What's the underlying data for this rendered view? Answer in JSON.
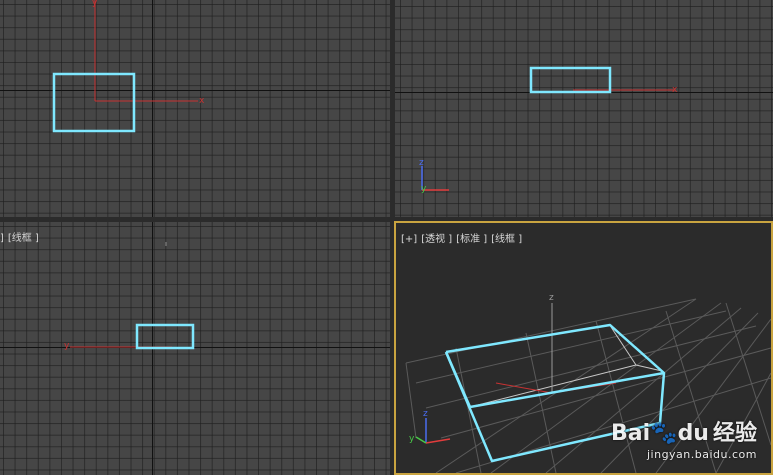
{
  "viewports": {
    "left": {
      "labels": [
        "]",
        "[线框 ]"
      ]
    },
    "perspective": {
      "labels": [
        "[+]",
        "[透视 ]",
        "[标准 ]",
        "[线框 ]"
      ]
    }
  },
  "axis_labels": {
    "x": "x",
    "y": "y",
    "z": "z"
  },
  "colors": {
    "selection": "#7fe8ff",
    "axis": "#c83232",
    "gizmo_x": "#e23c3c",
    "gizmo_y": "#48c848",
    "gizmo_z": "#4a6cf0",
    "active_border": "#c9a440"
  },
  "watermark": {
    "logo": "Bai🐾du",
    "cn": "经验",
    "url": "jingyan.baidu.com"
  }
}
